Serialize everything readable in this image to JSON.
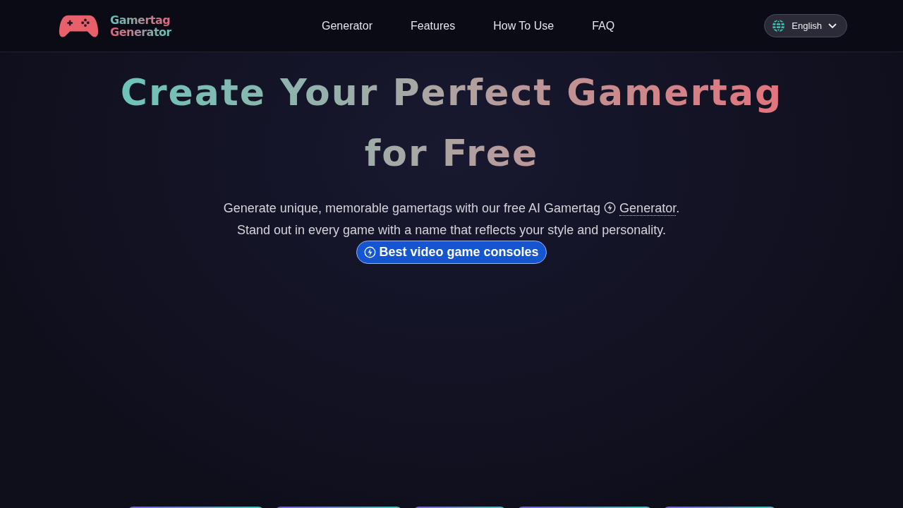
{
  "header": {
    "logo": {
      "line_1": "Gamertag",
      "line_2": "Generator"
    },
    "nav": [
      {
        "label": "Generator"
      },
      {
        "label": "Features"
      },
      {
        "label": "How To Use"
      },
      {
        "label": "FAQ"
      }
    ],
    "language": {
      "label": "English"
    }
  },
  "hero": {
    "title": "Create Your Perfect Gamertag for Free",
    "intro": "Generate unique, memorable gamertags with our free AI Gamertag",
    "intro_link": "Generator",
    "intro_end": ".",
    "line_2": "Stand out in every game with a name that reflects your style and personality.",
    "button": "Best video game consoles"
  },
  "bottom_tabs": [
    {
      "kind": "pill"
    },
    {
      "kind": "pill"
    },
    {
      "kind": "pill"
    },
    {
      "kind": "pill"
    },
    {
      "kind": "pill"
    }
  ]
}
